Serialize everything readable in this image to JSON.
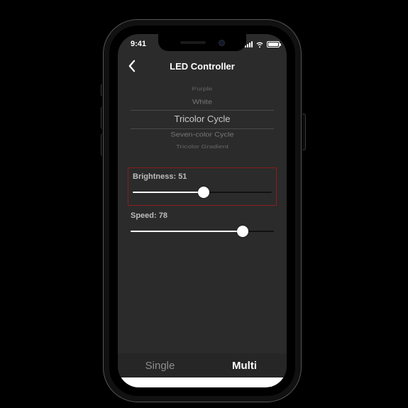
{
  "status": {
    "time": "9:41"
  },
  "header": {
    "title": "LED Controller"
  },
  "picker": {
    "items": [
      "",
      "Purple",
      "White",
      "Tricolor Cycle",
      "Seven-color Cycle",
      "Tricolor Gradient",
      ""
    ],
    "selected_index": 3
  },
  "sliders": {
    "brightness": {
      "label_prefix": "Brightness:",
      "value": 51,
      "min": 0,
      "max": 100,
      "highlighted": true
    },
    "speed": {
      "label_prefix": "Speed:",
      "value": 78,
      "min": 0,
      "max": 100,
      "highlighted": false
    }
  },
  "tabs": {
    "items": [
      {
        "label": "Single",
        "active": false
      },
      {
        "label": "Multi",
        "active": true
      }
    ]
  },
  "colors": {
    "highlight_border": "#8a1d1d",
    "screen_bg": "#2b2b2b"
  }
}
